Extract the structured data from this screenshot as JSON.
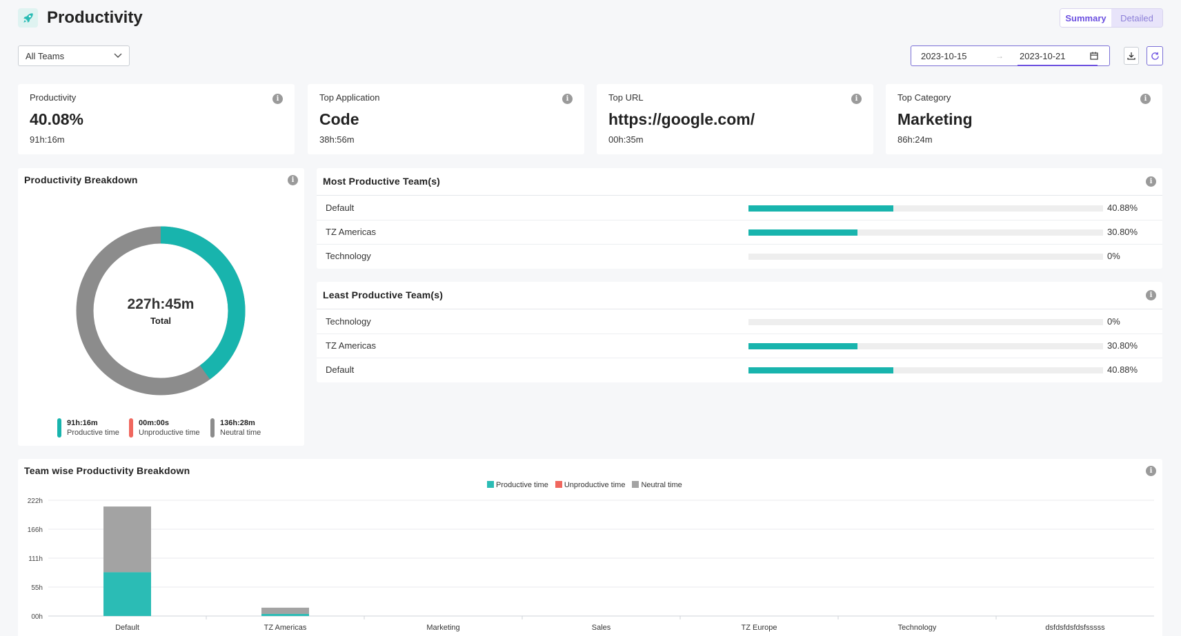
{
  "header": {
    "title": "Productivity",
    "views": [
      "Summary",
      "Detailed"
    ],
    "active_view": "Summary"
  },
  "filters": {
    "team_selected": "All Teams",
    "date_start": "2023-10-15",
    "date_end": "2023-10-21",
    "arrow": "→"
  },
  "stats": [
    {
      "label": "Productivity",
      "value": "40.08%",
      "sub": "91h:16m"
    },
    {
      "label": "Top Application",
      "value": "Code",
      "sub": "38h:56m"
    },
    {
      "label": "Top URL",
      "value": "https://google.com/",
      "sub": "00h:35m"
    },
    {
      "label": "Top Category",
      "value": "Marketing",
      "sub": "86h:24m"
    }
  ],
  "breakdown": {
    "title": "Productivity Breakdown",
    "total": "227h:45m",
    "total_label": "Total",
    "productive_fraction": 0.4008,
    "legend": [
      {
        "time": "91h:16m",
        "label": "Productive time",
        "color": "#18b4ad"
      },
      {
        "time": "00m:00s",
        "label": "Unproductive time",
        "color": "#f0675e"
      },
      {
        "time": "136h:28m",
        "label": "Neutral time",
        "color": "#8c8c8c"
      }
    ]
  },
  "most_productive": {
    "title": "Most Productive Team(s)",
    "rows": [
      {
        "name": "Default",
        "pct": "40.88%",
        "value": 0.4088
      },
      {
        "name": "TZ Americas",
        "pct": "30.80%",
        "value": 0.308
      },
      {
        "name": "Technology",
        "pct": "0%",
        "value": 0
      }
    ]
  },
  "least_productive": {
    "title": "Least Productive Team(s)",
    "rows": [
      {
        "name": "Technology",
        "pct": "0%",
        "value": 0
      },
      {
        "name": "TZ Americas",
        "pct": "30.80%",
        "value": 0.308
      },
      {
        "name": "Default",
        "pct": "40.88%",
        "value": 0.4088
      }
    ]
  },
  "team_chart_title": "Team wise Productivity Breakdown",
  "chart_data": {
    "type": "bar",
    "stacked": true,
    "categories": [
      "Default",
      "TZ Americas",
      "Marketing",
      "Sales",
      "TZ Europe",
      "Technology",
      "dsfdsfdsfdsfsssss"
    ],
    "series": [
      {
        "name": "Productive time",
        "color": "#2bbcb5",
        "values": [
          84,
          4,
          0,
          0,
          0,
          0,
          0
        ]
      },
      {
        "name": "Unproductive time",
        "color": "#f0675e",
        "values": [
          0,
          0,
          0,
          0,
          0,
          0,
          0
        ]
      },
      {
        "name": "Neutral time",
        "color": "#a3a3a3",
        "values": [
          126,
          12,
          0,
          0,
          0,
          0,
          0
        ]
      }
    ],
    "yticks": [
      "00h",
      "55h",
      "111h",
      "166h",
      "222h"
    ],
    "ylim": [
      0,
      222
    ],
    "grid": true,
    "legend_position": "top-center"
  },
  "colors": {
    "accent": "#6b4fe0",
    "productive": "#18b4ad"
  }
}
